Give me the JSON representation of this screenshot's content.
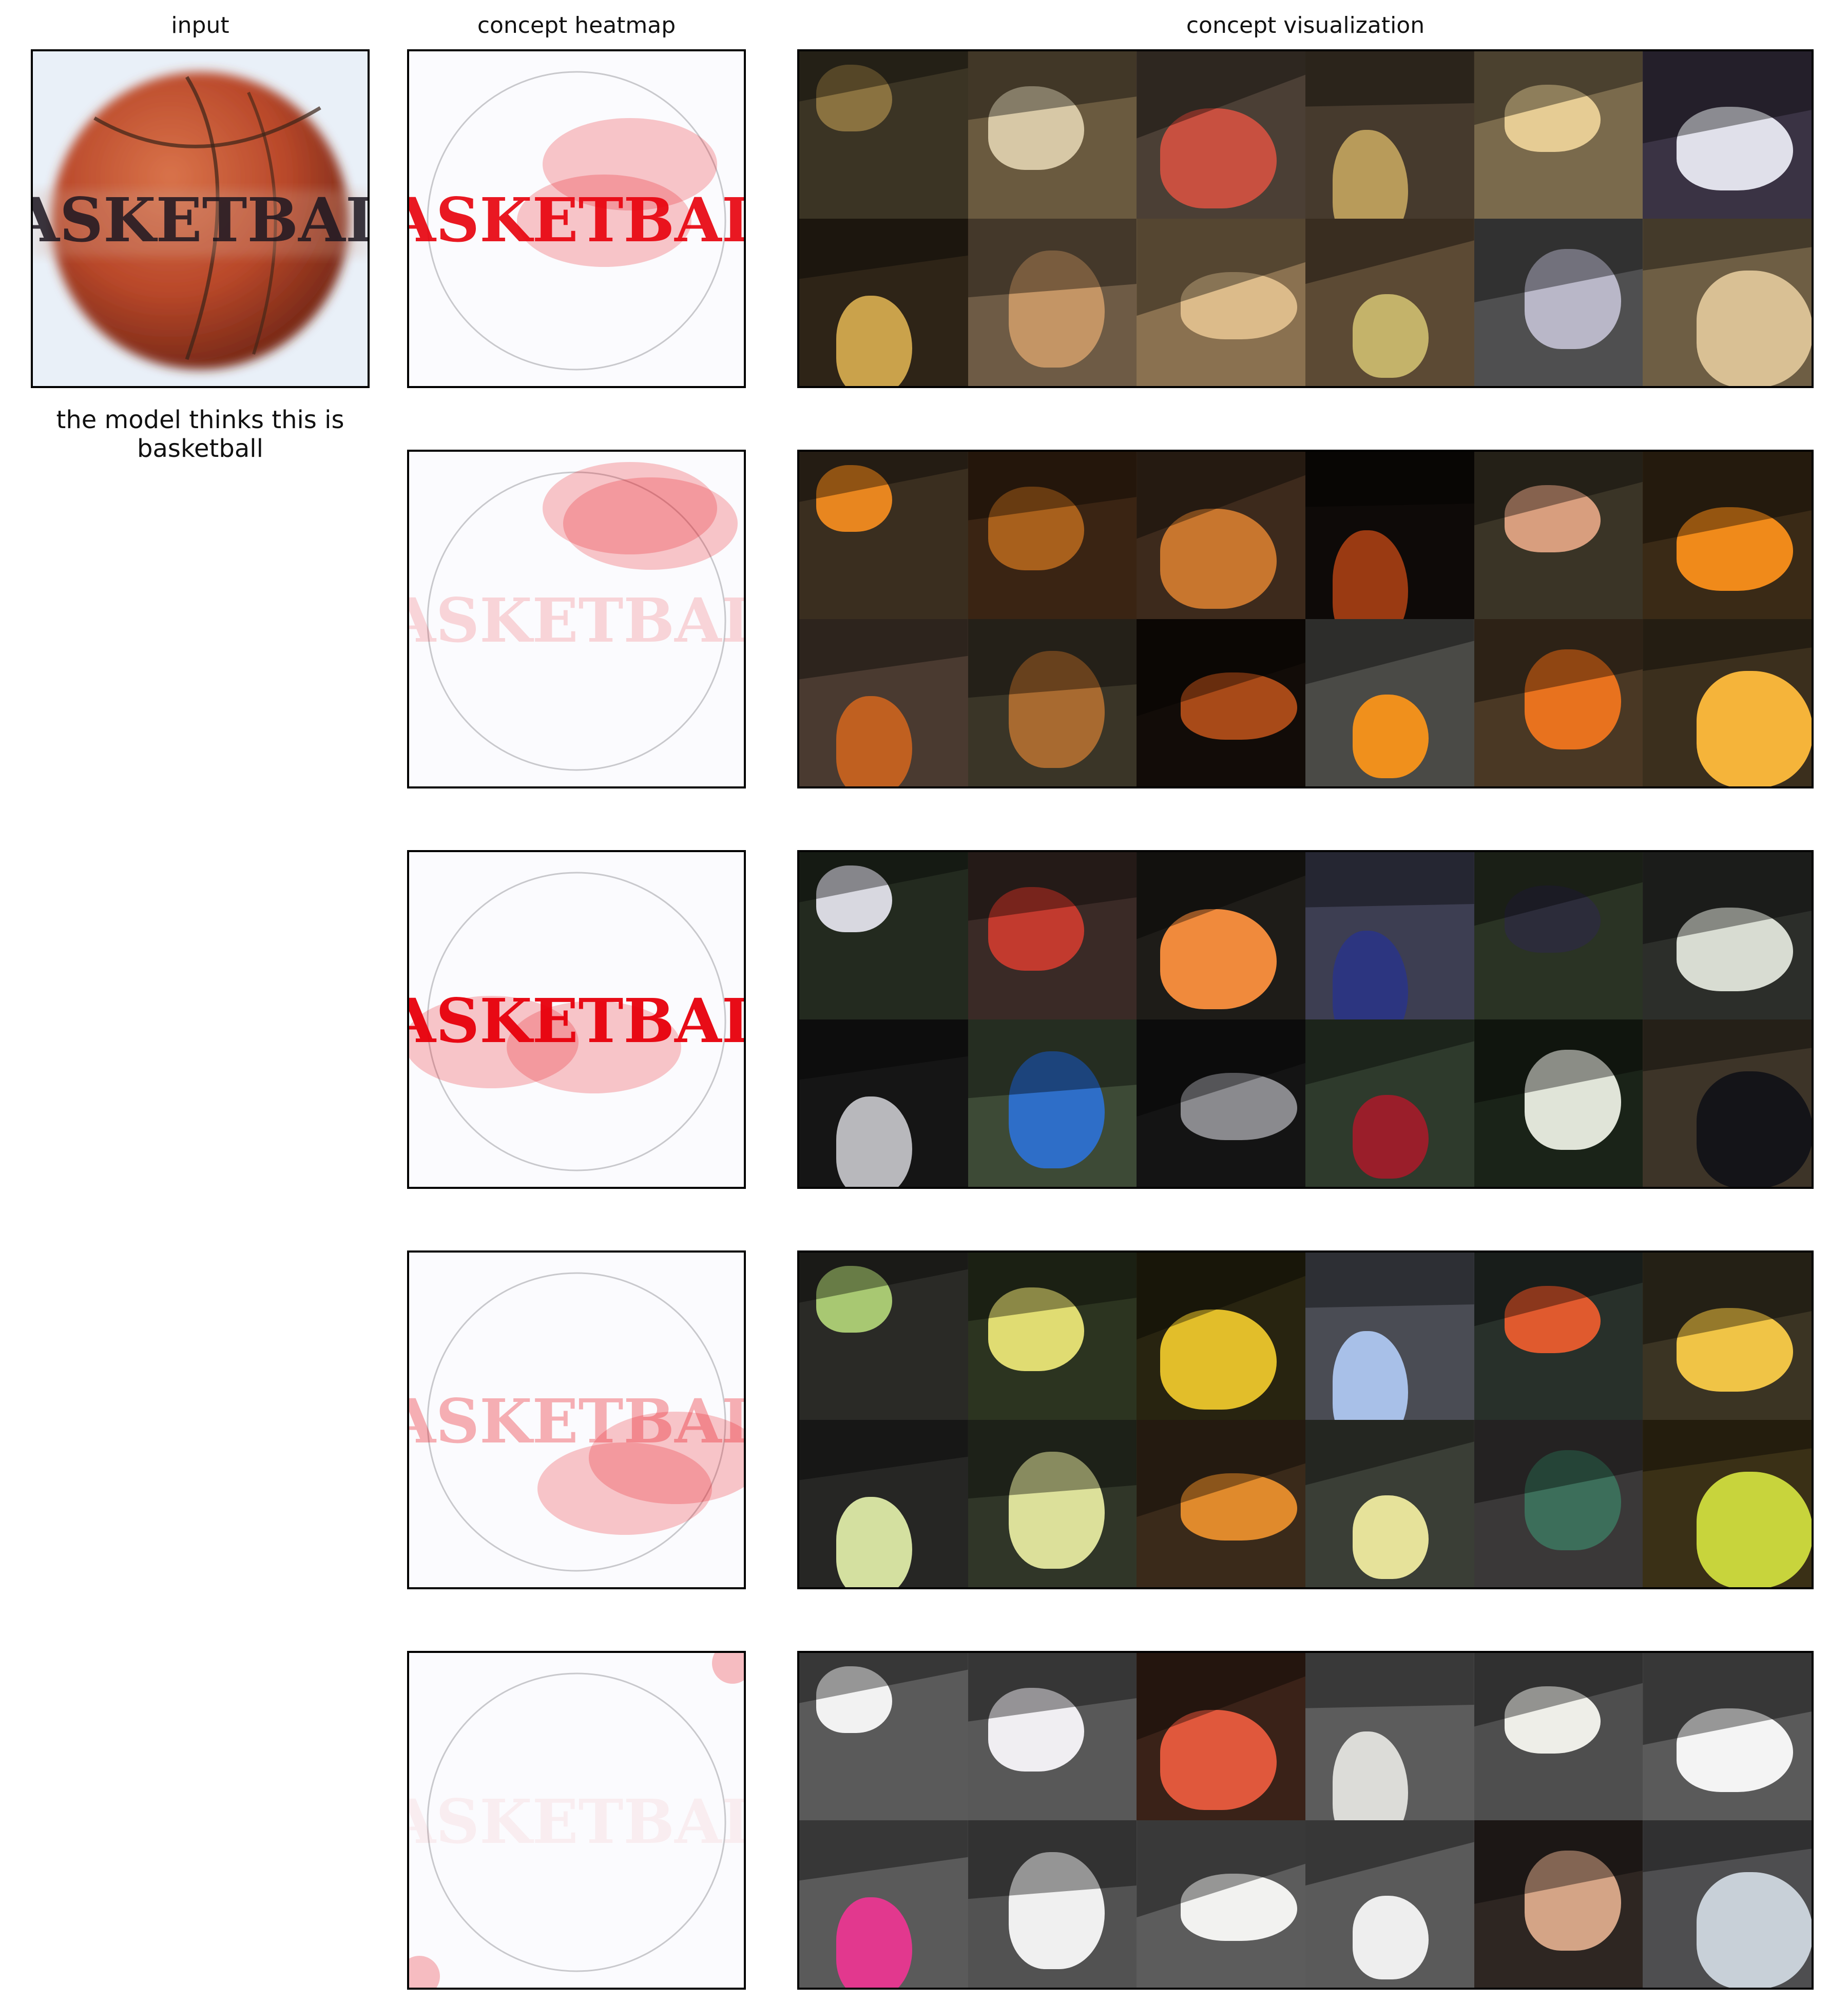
{
  "titles": {
    "input": "input",
    "heatmap": "concept heatmap",
    "visualization": "concept visualization"
  },
  "caption": "the model thinks this is basketball",
  "input_image": {
    "text": "ASKETBAL",
    "ball_color": "#c8552e"
  },
  "heatmap_color": "#e8000b",
  "concepts": [
    {
      "tiles": [
        {
          "bg": "#3b3424",
          "fg": "#8a7240"
        },
        {
          "bg": "#6a5a3f",
          "fg": "#d7c8a6"
        },
        {
          "bg": "#4b3f35",
          "fg": "#c85040"
        },
        {
          "bg": "#463a2d",
          "fg": "#b89b5a"
        },
        {
          "bg": "#7a6a4c",
          "fg": "#e6cc94"
        },
        {
          "bg": "#3a3344",
          "fg": "#e0e0ea"
        },
        {
          "bg": "#2e2417",
          "fg": "#caa24b"
        },
        {
          "bg": "#6e5b45",
          "fg": "#c49565"
        },
        {
          "bg": "#8a7150",
          "fg": "#dcbb8a"
        },
        {
          "bg": "#5c4a34",
          "fg": "#c4b36a"
        },
        {
          "bg": "#4f4f50",
          "fg": "#b9b7c8"
        },
        {
          "bg": "#6e5e44",
          "fg": "#d9c094"
        }
      ]
    },
    {
      "tiles": [
        {
          "bg": "#3a2e1f",
          "fg": "#e8861f"
        },
        {
          "bg": "#3a2413",
          "fg": "#a8601c"
        },
        {
          "bg": "#3d2a1c",
          "fg": "#c8762e"
        },
        {
          "bg": "#0e0a08",
          "fg": "#9a3a12"
        },
        {
          "bg": "#3a3426",
          "fg": "#d89e7e"
        },
        {
          "bg": "#3a2a16",
          "fg": "#f08a1a"
        },
        {
          "bg": "#4a3a30",
          "fg": "#c06020"
        },
        {
          "bg": "#3a3527",
          "fg": "#a86a30"
        },
        {
          "bg": "#120c08",
          "fg": "#a84a18"
        },
        {
          "bg": "#4a4a46",
          "fg": "#f0901c"
        },
        {
          "bg": "#4a3824",
          "fg": "#e8721e"
        },
        {
          "bg": "#3b2f1d",
          "fg": "#f5b43a"
        }
      ]
    },
    {
      "tiles": [
        {
          "bg": "#232a1f",
          "fg": "#d8d8e0"
        },
        {
          "bg": "#3a2a26",
          "fg": "#c23a2e"
        },
        {
          "bg": "#1e1c18",
          "fg": "#f08a3c"
        },
        {
          "bg": "#3d3e52",
          "fg": "#2c3580"
        },
        {
          "bg": "#2a3324",
          "fg": "#2c2c3a"
        },
        {
          "bg": "#2c2e2a",
          "fg": "#d8dcd2"
        },
        {
          "bg": "#151515",
          "fg": "#b8b8bc"
        },
        {
          "bg": "#3d4a36",
          "fg": "#2e6ec8"
        },
        {
          "bg": "#141414",
          "fg": "#8a8a8e"
        },
        {
          "bg": "#2e3a2c",
          "fg": "#9a1e2a"
        },
        {
          "bg": "#1a2318",
          "fg": "#e0e4d8"
        },
        {
          "bg": "#3d3428",
          "fg": "#141418"
        }
      ]
    },
    {
      "tiles": [
        {
          "bg": "#2a2a26",
          "fg": "#a8c872"
        },
        {
          "bg": "#2c3420",
          "fg": "#e0dc72"
        },
        {
          "bg": "#282410",
          "fg": "#e2be2a"
        },
        {
          "bg": "#4a4c54",
          "fg": "#a8c0e8"
        },
        {
          "bg": "#28302a",
          "fg": "#e05a2e"
        },
        {
          "bg": "#3b3423",
          "fg": "#f0c446"
        },
        {
          "bg": "#262624",
          "fg": "#d4e0a0"
        },
        {
          "bg": "#303628",
          "fg": "#dce09a"
        },
        {
          "bg": "#3a2a1a",
          "fg": "#e08a2c"
        },
        {
          "bg": "#3a3e36",
          "fg": "#e6e29a"
        },
        {
          "bg": "#3a3838",
          "fg": "#3c6e5a"
        },
        {
          "bg": "#3a3016",
          "fg": "#c8d43c"
        }
      ]
    },
    {
      "tiles": [
        {
          "bg": "#5a5a5a",
          "fg": "#f2f2f2"
        },
        {
          "bg": "#585858",
          "fg": "#f0eef2"
        },
        {
          "bg": "#3a2218",
          "fg": "#e0583c"
        },
        {
          "bg": "#5c5c5c",
          "fg": "#dcdcd8"
        },
        {
          "bg": "#4e4e4e",
          "fg": "#eeeee8"
        },
        {
          "bg": "#5a5a5a",
          "fg": "#f4f4f4"
        },
        {
          "bg": "#5a5a5a",
          "fg": "#e2388e"
        },
        {
          "bg": "#525252",
          "fg": "#f0f0f0"
        },
        {
          "bg": "#5c5c5c",
          "fg": "#f2f2f0"
        },
        {
          "bg": "#5a5a5a",
          "fg": "#eeeeee"
        },
        {
          "bg": "#2e2622",
          "fg": "#d4a486"
        },
        {
          "bg": "#4e4e50",
          "fg": "#c8d0d8"
        }
      ]
    }
  ]
}
